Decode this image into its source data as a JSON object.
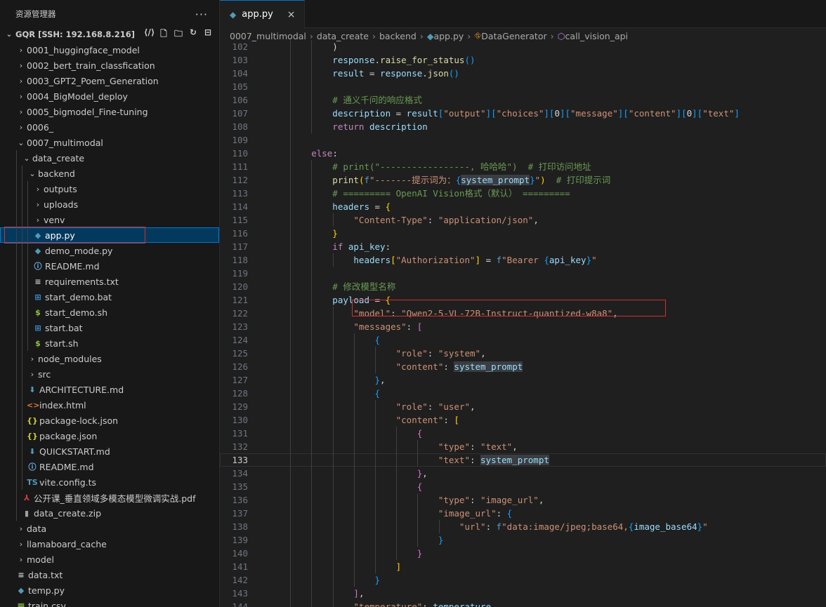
{
  "explorer": {
    "title": "资源管理器",
    "more": "···",
    "root_label": "GQR [SSH: 192.168.8.216]",
    "items": [
      {
        "label": "0001_huggingface_model",
        "depth": 1,
        "type": "folder",
        "open": false
      },
      {
        "label": "0002_bert_train_classfication",
        "depth": 1,
        "type": "folder",
        "open": false
      },
      {
        "label": "0003_GPT2_Poem_Generation",
        "depth": 1,
        "type": "folder",
        "open": false
      },
      {
        "label": "0004_BigModel_deploy",
        "depth": 1,
        "type": "folder",
        "open": false
      },
      {
        "label": "0005_bigmodel_Fine-tuning",
        "depth": 1,
        "type": "folder",
        "open": false
      },
      {
        "label": "0006_",
        "depth": 1,
        "type": "folder",
        "open": false
      },
      {
        "label": "0007_multimodal",
        "depth": 1,
        "type": "folder",
        "open": true
      },
      {
        "label": "data_create",
        "depth": 2,
        "type": "folder",
        "open": true
      },
      {
        "label": "backend",
        "depth": 3,
        "type": "folder",
        "open": true
      },
      {
        "label": "outputs",
        "depth": 4,
        "type": "folder",
        "open": false
      },
      {
        "label": "uploads",
        "depth": 4,
        "type": "folder",
        "open": false
      },
      {
        "label": "venv",
        "depth": 4,
        "type": "folder",
        "open": false
      },
      {
        "label": "app.py",
        "depth": 4,
        "type": "py",
        "selected": true
      },
      {
        "label": "demo_mode.py",
        "depth": 4,
        "type": "py"
      },
      {
        "label": "README.md",
        "depth": 4,
        "type": "info"
      },
      {
        "label": "requirements.txt",
        "depth": 4,
        "type": "txt"
      },
      {
        "label": "start_demo.bat",
        "depth": 4,
        "type": "bat"
      },
      {
        "label": "start_demo.sh",
        "depth": 4,
        "type": "sh"
      },
      {
        "label": "start.bat",
        "depth": 4,
        "type": "bat"
      },
      {
        "label": "start.sh",
        "depth": 4,
        "type": "sh"
      },
      {
        "label": "node_modules",
        "depth": 3,
        "type": "folder",
        "open": false
      },
      {
        "label": "src",
        "depth": 3,
        "type": "folder",
        "open": false
      },
      {
        "label": "ARCHITECTURE.md",
        "depth": 3,
        "type": "mdarrow"
      },
      {
        "label": "index.html",
        "depth": 3,
        "type": "html"
      },
      {
        "label": "package-lock.json",
        "depth": 3,
        "type": "json"
      },
      {
        "label": "package.json",
        "depth": 3,
        "type": "json"
      },
      {
        "label": "QUICKSTART.md",
        "depth": 3,
        "type": "mdarrow"
      },
      {
        "label": "README.md",
        "depth": 3,
        "type": "info"
      },
      {
        "label": "vite.config.ts",
        "depth": 3,
        "type": "ts"
      },
      {
        "label": "公开课_垂直领域多模态模型微调实战.pdf",
        "depth": 2,
        "type": "pdf"
      },
      {
        "label": "data_create.zip",
        "depth": 2,
        "type": "zip"
      },
      {
        "label": "data",
        "depth": 1,
        "type": "folder",
        "open": false
      },
      {
        "label": "llamaboard_cache",
        "depth": 1,
        "type": "folder",
        "open": false
      },
      {
        "label": "model",
        "depth": 1,
        "type": "folder",
        "open": false
      },
      {
        "label": "data.txt",
        "depth": 1,
        "type": "txt"
      },
      {
        "label": "temp.py",
        "depth": 1,
        "type": "py"
      },
      {
        "label": "train.csv",
        "depth": 1,
        "type": "csv"
      }
    ]
  },
  "editor": {
    "tab_label": "app.py",
    "close_glyph": "×",
    "breadcrumb": [
      "0007_multimodal",
      "data_create",
      "backend",
      "app.py",
      "DataGenerator",
      "call_vision_api"
    ],
    "current_line": 133,
    "lines": [
      {
        "n": 102,
        "indent": 3,
        "t": [
          [
            "t-op",
            "            )"
          ]
        ]
      },
      {
        "n": 103,
        "indent": 3,
        "t": [
          [
            "t-var",
            "            response"
          ],
          [
            "t-op",
            "."
          ],
          [
            "t-fn",
            "raise_for_status"
          ],
          [
            "t-b3",
            "()"
          ]
        ]
      },
      {
        "n": 104,
        "indent": 3,
        "t": [
          [
            "t-var",
            "            result"
          ],
          [
            "t-op",
            " = "
          ],
          [
            "t-var",
            "response"
          ],
          [
            "t-op",
            "."
          ],
          [
            "t-fn",
            "json"
          ],
          [
            "t-b3",
            "()"
          ]
        ]
      },
      {
        "n": 105,
        "indent": 3,
        "t": []
      },
      {
        "n": 106,
        "indent": 3,
        "t": [
          [
            "t-cm",
            "            # 通义千问的响应格式"
          ]
        ]
      },
      {
        "n": 107,
        "indent": 3,
        "t": [
          [
            "t-var",
            "            description"
          ],
          [
            "t-op",
            " = "
          ],
          [
            "t-var",
            "result"
          ],
          [
            "t-b3",
            "["
          ],
          [
            "t-st",
            "\"output\""
          ],
          [
            "t-b3",
            "]["
          ],
          [
            "t-st",
            "\"choices\""
          ],
          [
            "t-b3",
            "]["
          ],
          [
            "t-op",
            "0"
          ],
          [
            "t-b3",
            "]["
          ],
          [
            "t-st",
            "\"message\""
          ],
          [
            "t-b3",
            "]["
          ],
          [
            "t-st",
            "\"content\""
          ],
          [
            "t-b3",
            "]["
          ],
          [
            "t-op",
            "0"
          ],
          [
            "t-b3",
            "]["
          ],
          [
            "t-st",
            "\"text\""
          ],
          [
            "t-b3",
            "]"
          ]
        ]
      },
      {
        "n": 108,
        "indent": 3,
        "t": [
          [
            "t-kw",
            "            return "
          ],
          [
            "t-var",
            "description"
          ]
        ]
      },
      {
        "n": 109,
        "indent": 2,
        "t": []
      },
      {
        "n": 110,
        "indent": 2,
        "t": [
          [
            "t-kw",
            "        else"
          ],
          [
            "t-op",
            ":"
          ]
        ]
      },
      {
        "n": 111,
        "indent": 3,
        "t": [
          [
            "t-cm",
            "            # print(\"-----------------, 哈哈哈\")  # 打印访问地址"
          ]
        ]
      },
      {
        "n": 112,
        "indent": 3,
        "t": [
          [
            "t-fn",
            "            print"
          ],
          [
            "t-b1",
            "("
          ],
          [
            "t-fs",
            "f"
          ],
          [
            "t-st",
            "\"-------提示词为："
          ],
          [
            "t-b3",
            "{"
          ],
          [
            "t-hl",
            "system_prompt"
          ],
          [
            "t-b3",
            "}"
          ],
          [
            "t-st",
            "\""
          ],
          [
            "t-b1",
            ")"
          ],
          [
            "t-cm",
            "  # 打印提示词"
          ]
        ]
      },
      {
        "n": 113,
        "indent": 3,
        "t": [
          [
            "t-cm",
            "            # ========= OpenAI Vision格式（默认） ========="
          ]
        ]
      },
      {
        "n": 114,
        "indent": 3,
        "t": [
          [
            "t-var",
            "            headers"
          ],
          [
            "t-op",
            " = "
          ],
          [
            "t-b1",
            "{"
          ]
        ]
      },
      {
        "n": 115,
        "indent": 4,
        "t": [
          [
            "t-st",
            "                \"Content-Type\""
          ],
          [
            "t-op",
            ": "
          ],
          [
            "t-st",
            "\"application/json\""
          ],
          [
            "t-op",
            ","
          ]
        ]
      },
      {
        "n": 116,
        "indent": 3,
        "t": [
          [
            "t-b1",
            "            }"
          ]
        ]
      },
      {
        "n": 117,
        "indent": 3,
        "t": [
          [
            "t-kw",
            "            if "
          ],
          [
            "t-var",
            "api_key"
          ],
          [
            "t-op",
            ":"
          ]
        ]
      },
      {
        "n": 118,
        "indent": 4,
        "t": [
          [
            "t-var",
            "                headers"
          ],
          [
            "t-b1",
            "["
          ],
          [
            "t-st",
            "\"Authorization\""
          ],
          [
            "t-b1",
            "]"
          ],
          [
            "t-op",
            " = "
          ],
          [
            "t-fs",
            "f"
          ],
          [
            "t-st",
            "\"Bearer "
          ],
          [
            "t-b3",
            "{"
          ],
          [
            "t-var",
            "api_key"
          ],
          [
            "t-b3",
            "}"
          ],
          [
            "t-st",
            "\""
          ]
        ]
      },
      {
        "n": 119,
        "indent": 3,
        "t": []
      },
      {
        "n": 120,
        "indent": 3,
        "t": [
          [
            "t-cm",
            "            # 修改模型名称"
          ]
        ]
      },
      {
        "n": 121,
        "indent": 3,
        "t": [
          [
            "t-var",
            "            payload"
          ],
          [
            "t-op",
            " = "
          ],
          [
            "t-b1",
            "{"
          ]
        ]
      },
      {
        "n": 122,
        "indent": 4,
        "t": [
          [
            "t-st",
            "                \"model\""
          ],
          [
            "t-op",
            ": "
          ],
          [
            "t-st",
            "\"Qwen2-5-VL-72B-Instruct-quantized-w8a8\""
          ],
          [
            "t-op",
            ","
          ]
        ]
      },
      {
        "n": 123,
        "indent": 4,
        "t": [
          [
            "t-st",
            "                \"messages\""
          ],
          [
            "t-op",
            ": "
          ],
          [
            "t-b2",
            "["
          ]
        ]
      },
      {
        "n": 124,
        "indent": 5,
        "t": [
          [
            "t-b3",
            "                    {"
          ]
        ]
      },
      {
        "n": 125,
        "indent": 6,
        "t": [
          [
            "t-st",
            "                        \"role\""
          ],
          [
            "t-op",
            ": "
          ],
          [
            "t-st",
            "\"system\""
          ],
          [
            "t-op",
            ","
          ]
        ]
      },
      {
        "n": 126,
        "indent": 6,
        "t": [
          [
            "t-st",
            "                        \"content\""
          ],
          [
            "t-op",
            ": "
          ],
          [
            "t-hl",
            "system_prompt"
          ]
        ]
      },
      {
        "n": 127,
        "indent": 5,
        "t": [
          [
            "t-b3",
            "                    }"
          ],
          [
            "t-op",
            ","
          ]
        ]
      },
      {
        "n": 128,
        "indent": 5,
        "t": [
          [
            "t-b3",
            "                    {"
          ]
        ]
      },
      {
        "n": 129,
        "indent": 6,
        "t": [
          [
            "t-st",
            "                        \"role\""
          ],
          [
            "t-op",
            ": "
          ],
          [
            "t-st",
            "\"user\""
          ],
          [
            "t-op",
            ","
          ]
        ]
      },
      {
        "n": 130,
        "indent": 6,
        "t": [
          [
            "t-st",
            "                        \"content\""
          ],
          [
            "t-op",
            ": "
          ],
          [
            "t-b1",
            "["
          ]
        ]
      },
      {
        "n": 131,
        "indent": 7,
        "t": [
          [
            "t-b2",
            "                            {"
          ]
        ]
      },
      {
        "n": 132,
        "indent": 8,
        "t": [
          [
            "t-st",
            "                                \"type\""
          ],
          [
            "t-op",
            ": "
          ],
          [
            "t-st",
            "\"text\""
          ],
          [
            "t-op",
            ","
          ]
        ]
      },
      {
        "n": 133,
        "indent": 8,
        "t": [
          [
            "t-st",
            "                                \"text\""
          ],
          [
            "t-op",
            ": "
          ],
          [
            "t-hl",
            "system_prompt"
          ]
        ]
      },
      {
        "n": 134,
        "indent": 7,
        "t": [
          [
            "t-b2",
            "                            }"
          ],
          [
            "t-op",
            ","
          ]
        ]
      },
      {
        "n": 135,
        "indent": 7,
        "t": [
          [
            "t-b2",
            "                            {"
          ]
        ]
      },
      {
        "n": 136,
        "indent": 8,
        "t": [
          [
            "t-st",
            "                                \"type\""
          ],
          [
            "t-op",
            ": "
          ],
          [
            "t-st",
            "\"image_url\""
          ],
          [
            "t-op",
            ","
          ]
        ]
      },
      {
        "n": 137,
        "indent": 8,
        "t": [
          [
            "t-st",
            "                                \"image_url\""
          ],
          [
            "t-op",
            ": "
          ],
          [
            "t-b3",
            "{"
          ]
        ]
      },
      {
        "n": 138,
        "indent": 9,
        "t": [
          [
            "t-st",
            "                                    \"url\""
          ],
          [
            "t-op",
            ": "
          ],
          [
            "t-fs",
            "f"
          ],
          [
            "t-st",
            "\"data:image/jpeg;base64,"
          ],
          [
            "t-b3",
            "{"
          ],
          [
            "t-var",
            "image_base64"
          ],
          [
            "t-b3",
            "}"
          ],
          [
            "t-st",
            "\""
          ]
        ]
      },
      {
        "n": 139,
        "indent": 8,
        "t": [
          [
            "t-b3",
            "                                }"
          ]
        ]
      },
      {
        "n": 140,
        "indent": 7,
        "t": [
          [
            "t-b2",
            "                            }"
          ]
        ]
      },
      {
        "n": 141,
        "indent": 6,
        "t": [
          [
            "t-b1",
            "                        ]"
          ]
        ]
      },
      {
        "n": 142,
        "indent": 5,
        "t": [
          [
            "t-b3",
            "                    }"
          ]
        ]
      },
      {
        "n": 143,
        "indent": 4,
        "t": [
          [
            "t-b2",
            "                ]"
          ],
          [
            "t-op",
            ","
          ]
        ]
      },
      {
        "n": 144,
        "indent": 4,
        "t": [
          [
            "t-st",
            "                \"temperature\""
          ],
          [
            "t-op",
            ": "
          ],
          [
            "t-var",
            "temperature"
          ],
          [
            "t-op",
            ","
          ]
        ]
      }
    ]
  }
}
